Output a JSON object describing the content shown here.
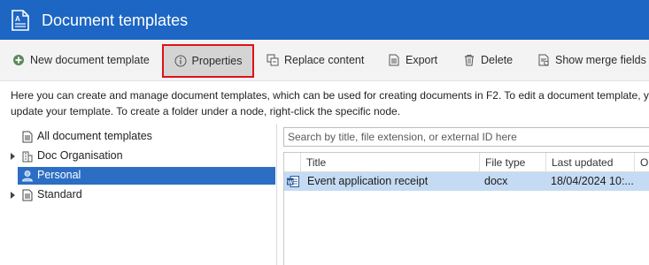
{
  "window": {
    "title": "Document templates"
  },
  "toolbar": {
    "new_label": "New document template",
    "properties_label": "Properties",
    "replace_label": "Replace content",
    "export_label": "Export",
    "delete_label": "Delete",
    "merge_label": "Show merge fields"
  },
  "description": {
    "line1": "Here you can create and manage document templates, which can be used for creating documents in F2. To edit a document template, yo",
    "line2": "update your template. To create a folder under a node, right-click the specific node."
  },
  "tree": {
    "items": [
      {
        "label": "All document templates"
      },
      {
        "label": "Doc Organisation"
      },
      {
        "label": "Personal"
      },
      {
        "label": "Standard"
      }
    ]
  },
  "search": {
    "placeholder": "Search by title, file extension, or external ID here"
  },
  "grid": {
    "columns": [
      "Title",
      "File type",
      "Last updated",
      "Ou"
    ],
    "rows": [
      {
        "title": "Event application receipt",
        "file_type": "docx",
        "last_updated": "18/04/2024 10:..."
      }
    ]
  },
  "colors": {
    "titlebar": "#1d66c3",
    "selection": "#2b6ec4",
    "row_selected": "#c5dbf3",
    "highlight_border": "#e0101a"
  }
}
